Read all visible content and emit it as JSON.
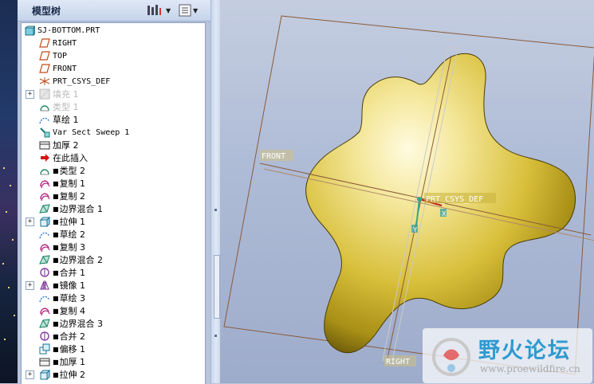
{
  "model_tree": {
    "title": "模型树",
    "tools": [
      {
        "name": "settings",
        "icon": "tree-settings-icon"
      },
      {
        "name": "show",
        "icon": "tree-filter-icon"
      }
    ],
    "items": [
      {
        "label": "SJ-BOTTOM.PRT",
        "icon": "part-icon",
        "prefix": "",
        "expandable": false,
        "mono": true,
        "dim": false,
        "level": 0
      },
      {
        "label": "RIGHT",
        "icon": "datum-plane-icon",
        "prefix": "",
        "expandable": false,
        "mono": true,
        "dim": false,
        "level": 1
      },
      {
        "label": "TOP",
        "icon": "datum-plane-icon",
        "prefix": "",
        "expandable": false,
        "mono": true,
        "dim": false,
        "level": 1
      },
      {
        "label": "FRONT",
        "icon": "datum-plane-icon",
        "prefix": "",
        "expandable": false,
        "mono": true,
        "dim": false,
        "level": 1
      },
      {
        "label": "PRT_CSYS_DEF",
        "icon": "csys-icon",
        "prefix": "",
        "expandable": false,
        "mono": true,
        "dim": false,
        "level": 1
      },
      {
        "label": "填充 1",
        "icon": "fill-icon",
        "prefix": "",
        "expandable": true,
        "mono": false,
        "dim": true,
        "level": 1
      },
      {
        "label": "类型 1",
        "icon": "style-icon",
        "prefix": "",
        "expandable": false,
        "mono": false,
        "dim": true,
        "level": 1
      },
      {
        "label": "草绘 1",
        "icon": "sketch-icon",
        "prefix": "",
        "expandable": false,
        "mono": false,
        "dim": false,
        "level": 1
      },
      {
        "label": "Var Sect Sweep 1",
        "icon": "sweep-icon",
        "prefix": "",
        "expandable": false,
        "mono": true,
        "dim": false,
        "level": 1
      },
      {
        "label": "加厚 2",
        "icon": "thicken-icon",
        "prefix": "",
        "expandable": false,
        "mono": false,
        "dim": false,
        "level": 1
      },
      {
        "label": "在此插入",
        "icon": "insert-here-icon",
        "prefix": "",
        "expandable": false,
        "mono": false,
        "dim": false,
        "level": 1
      },
      {
        "label": "类型 2",
        "icon": "style-icon",
        "prefix": "■",
        "expandable": false,
        "mono": false,
        "dim": false,
        "level": 1
      },
      {
        "label": "复制 1",
        "icon": "copy-icon",
        "prefix": "■",
        "expandable": false,
        "mono": false,
        "dim": false,
        "level": 1
      },
      {
        "label": "复制 2",
        "icon": "copy-icon",
        "prefix": "■",
        "expandable": false,
        "mono": false,
        "dim": false,
        "level": 1
      },
      {
        "label": "边界混合 1",
        "icon": "boundary-blend-icon",
        "prefix": "■",
        "expandable": false,
        "mono": false,
        "dim": false,
        "level": 1
      },
      {
        "label": "拉伸 1",
        "icon": "extrude-icon",
        "prefix": "■",
        "expandable": true,
        "mono": false,
        "dim": false,
        "level": 1
      },
      {
        "label": "草绘 2",
        "icon": "sketch-icon",
        "prefix": "■",
        "expandable": false,
        "mono": false,
        "dim": false,
        "level": 1
      },
      {
        "label": "复制 3",
        "icon": "copy-icon",
        "prefix": "■",
        "expandable": false,
        "mono": false,
        "dim": false,
        "level": 1
      },
      {
        "label": "边界混合 2",
        "icon": "boundary-blend-icon",
        "prefix": "■",
        "expandable": false,
        "mono": false,
        "dim": false,
        "level": 1
      },
      {
        "label": "合并 1",
        "icon": "merge-icon",
        "prefix": "■",
        "expandable": false,
        "mono": false,
        "dim": false,
        "level": 1
      },
      {
        "label": "镜像 1",
        "icon": "mirror-icon",
        "prefix": "■",
        "expandable": true,
        "mono": false,
        "dim": false,
        "level": 1
      },
      {
        "label": "草绘 3",
        "icon": "sketch-icon",
        "prefix": "■",
        "expandable": false,
        "mono": false,
        "dim": false,
        "level": 1
      },
      {
        "label": "复制 4",
        "icon": "copy-icon",
        "prefix": "■",
        "expandable": false,
        "mono": false,
        "dim": false,
        "level": 1
      },
      {
        "label": "边界混合 3",
        "icon": "boundary-blend-icon",
        "prefix": "■",
        "expandable": false,
        "mono": false,
        "dim": false,
        "level": 1
      },
      {
        "label": "合并 2",
        "icon": "merge-icon",
        "prefix": "■",
        "expandable": false,
        "mono": false,
        "dim": false,
        "level": 1
      },
      {
        "label": "偏移 1",
        "icon": "offset-icon",
        "prefix": "■",
        "expandable": false,
        "mono": false,
        "dim": false,
        "level": 1
      },
      {
        "label": "加厚 1",
        "icon": "thicken-icon",
        "prefix": "■",
        "expandable": false,
        "mono": false,
        "dim": false,
        "level": 1
      },
      {
        "label": "拉伸 2",
        "icon": "extrude-icon",
        "prefix": "■",
        "expandable": true,
        "mono": false,
        "dim": false,
        "level": 1
      }
    ]
  },
  "viewport": {
    "datum_labels": {
      "front": "FRONT",
      "right": "RIGHT",
      "csys": "PRT_CSYS_DEF"
    },
    "axis_labels": {
      "x": "X",
      "y": "Y"
    },
    "model_color": "#e8d04a",
    "datum_color": "#8a5a3a"
  },
  "watermark": {
    "title": "野火论坛",
    "url": "www.proewildfire.cn"
  }
}
